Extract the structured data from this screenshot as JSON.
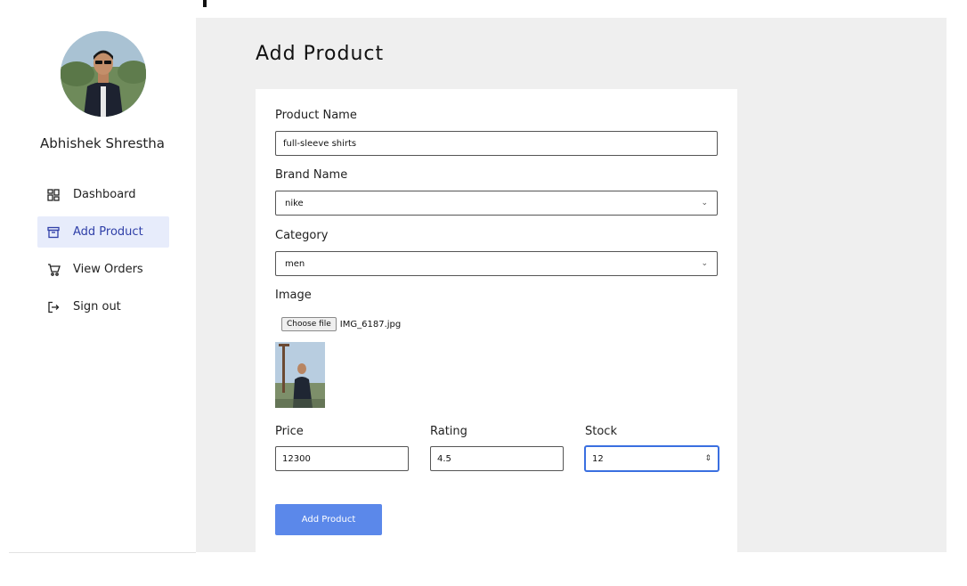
{
  "user": {
    "name": "Abhishek Shrestha"
  },
  "sidebar": {
    "items": [
      {
        "label": "Dashboard",
        "icon": "dashboard-grid-icon"
      },
      {
        "label": "Add Product",
        "icon": "archive-box-icon",
        "active": true
      },
      {
        "label": "View Orders",
        "icon": "shopping-cart-icon"
      },
      {
        "label": "Sign out",
        "icon": "sign-out-icon"
      }
    ]
  },
  "page": {
    "title": "Add Product"
  },
  "form": {
    "product_name": {
      "label": "Product Name",
      "value": "full-sleeve shirts"
    },
    "brand_name": {
      "label": "Brand Name",
      "value": "nike"
    },
    "category": {
      "label": "Category",
      "value": "men"
    },
    "image": {
      "label": "Image",
      "button_label": "Choose file",
      "file_name": "IMG_6187.jpg"
    },
    "price": {
      "label": "Price",
      "value": "12300"
    },
    "rating": {
      "label": "Rating",
      "value": "4.5"
    },
    "stock": {
      "label": "Stock",
      "value": "12"
    },
    "submit_label": "Add Product"
  },
  "colors": {
    "accent": "#5b88ea",
    "active_nav_bg": "#e7ecfb",
    "active_nav_text": "#2f3fa8",
    "content_bg": "#efefef"
  }
}
